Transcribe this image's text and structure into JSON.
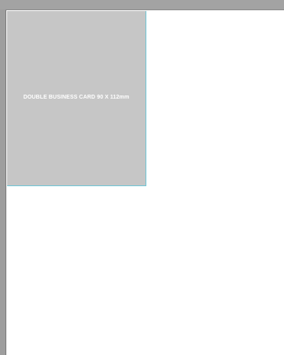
{
  "canvas": {
    "card": {
      "label": "DOUBLE BUSINESS CARD 90 X 112mm"
    }
  },
  "colors": {
    "pasteboard": "#a6a6a6",
    "page": "#ffffff",
    "card_fill": "#c6c6c6",
    "card_guide": "#6fc6d6",
    "card_text": "#ffffff"
  }
}
